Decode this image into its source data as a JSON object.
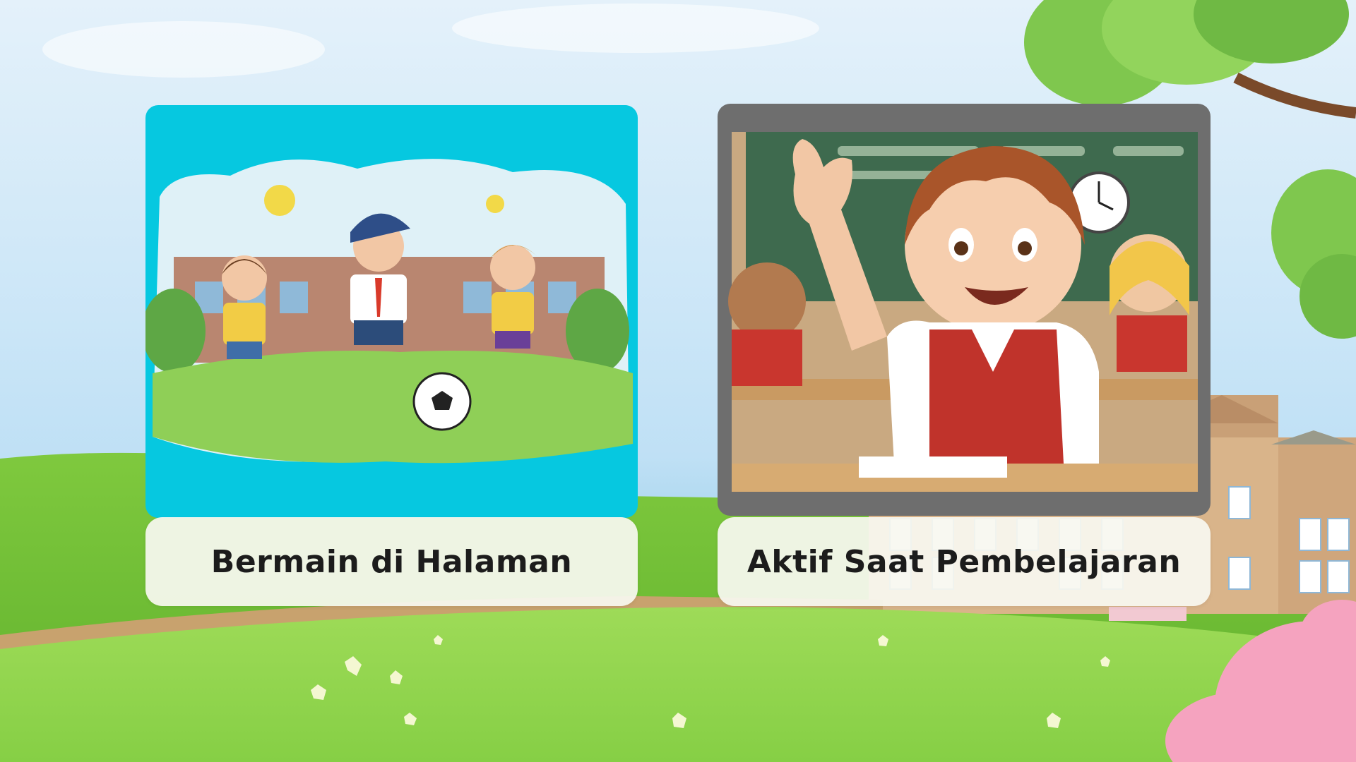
{
  "cards": [
    {
      "id": "playground",
      "caption": "Bermain di Halaman",
      "image": "kids-playing-soccer-illustration"
    },
    {
      "id": "classroom",
      "caption": "Aktif Saat Pembelajaran",
      "image": "boy-raising-hand-classroom-illustration"
    }
  ],
  "colors": {
    "sky": "#c9e5f7",
    "grass": "#8fd14a",
    "card_teal": "#06c8e0",
    "card_frame_gray": "#6e6e6e",
    "caption_bg": "#f8f7f0",
    "caption_text": "#1c1c1c"
  }
}
